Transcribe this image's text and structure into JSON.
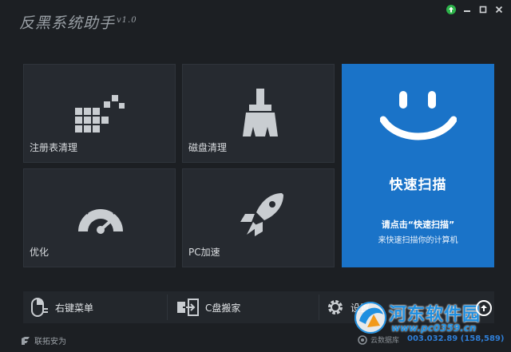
{
  "window": {
    "title": "反黑系统助手",
    "version": "v1.0",
    "controls": {
      "update_icon": "up-arrow-circle",
      "minimize": "minimize",
      "maximize": "maximize",
      "close": "close"
    }
  },
  "tiles": {
    "registry": {
      "label": "注册表清理",
      "icon": "grid-blocks-icon"
    },
    "disk": {
      "label": "磁盘清理",
      "icon": "broom-icon"
    },
    "optimize": {
      "label": "优化",
      "icon": "gauge-icon"
    },
    "pc": {
      "label": "PC加速",
      "icon": "rocket-icon"
    },
    "scan": {
      "title": "快速扫描",
      "hint_line1": "请点击“快速扫描”",
      "hint_line2": "来快速扫描你的计算机",
      "icon": "smiley-icon"
    }
  },
  "toolbar": {
    "right_menu": "右键菜单",
    "c_disk": "C盘搬家",
    "settings": "设置"
  },
  "footer": {
    "brand": "联拓安为",
    "db_label": "云数据库",
    "version_info": "003.032.89 (158,589)"
  },
  "watermark": {
    "name": "河东软件园",
    "url": "www.pc0359.cn"
  },
  "colors": {
    "background": "#1c1f23",
    "tile": "#262a30",
    "accent": "#1a73c8",
    "update_green": "#2db34a"
  }
}
